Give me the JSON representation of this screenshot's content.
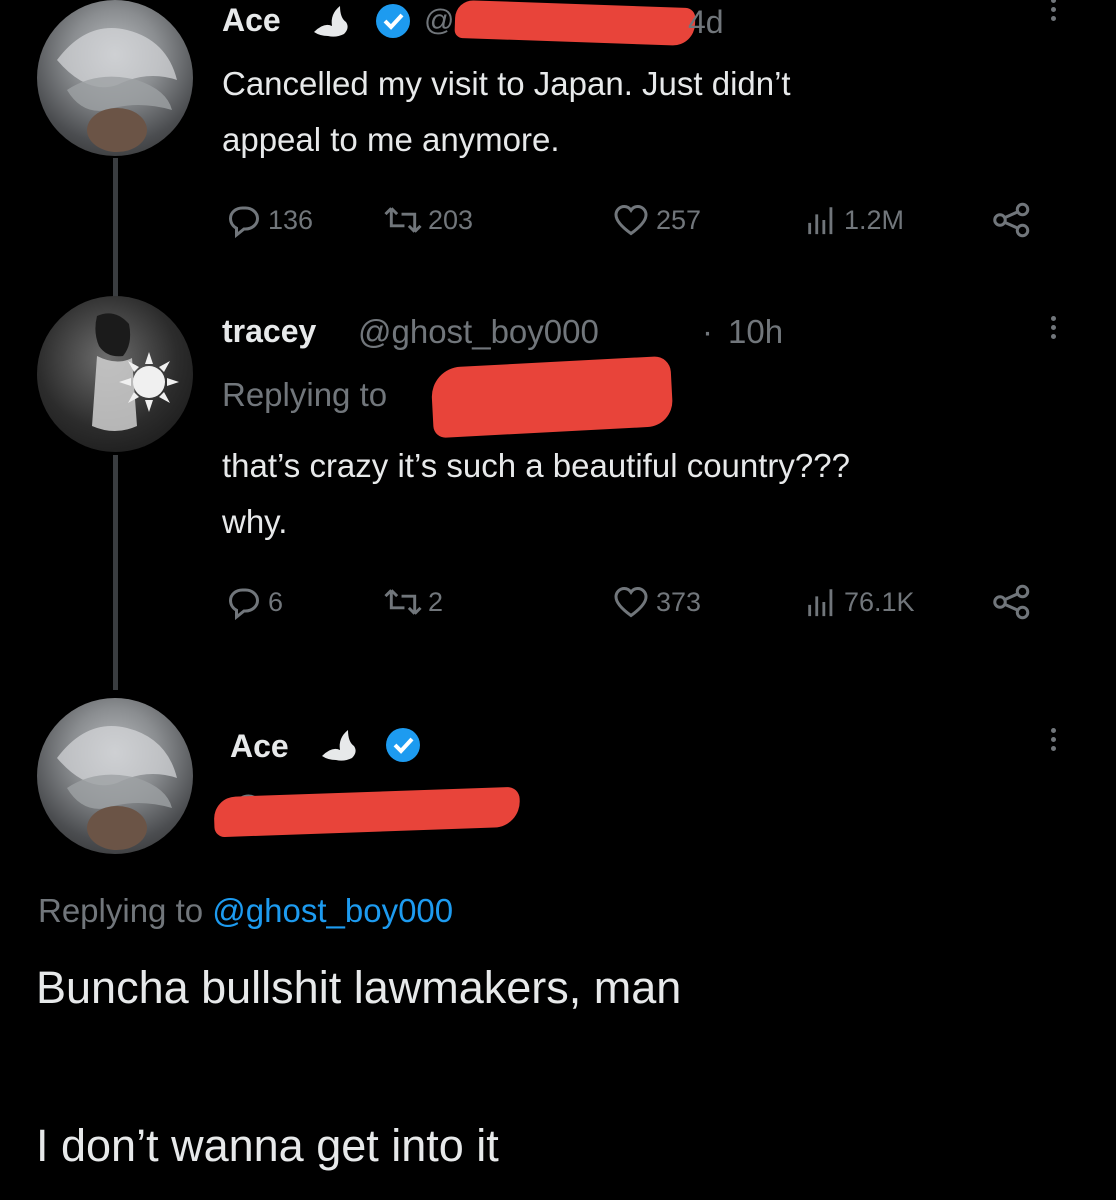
{
  "tweet1": {
    "name": "Ace",
    "handle_prefix": "@",
    "time": "4d",
    "text_line1": "Cancelled my visit to Japan. Just didn’t",
    "text_line2": "appeal to me anymore.",
    "stats": {
      "replies": "136",
      "retweets": "203",
      "likes": "257",
      "views": "1.2M"
    }
  },
  "tweet2": {
    "name": "tracey",
    "handle": "@ghost_boy000",
    "separator": "·",
    "time": "10h",
    "replying_label": "Replying to",
    "text_line1": "that’s crazy it’s such a beautiful country???",
    "text_line2": "why.",
    "stats": {
      "replies": "6",
      "retweets": "2",
      "likes": "373",
      "views": "76.1K"
    }
  },
  "tweet3": {
    "name": "Ace",
    "handle_prefix": "@",
    "replying_label": "Replying to",
    "replying_handle": "@ghost_boy000",
    "text_line1": "Buncha bullshit lawmakers, man",
    "text_line2": "I don’t wanna get into it"
  },
  "colors": {
    "background": "#000000",
    "text": "#e7e9ea",
    "muted": "#71767b",
    "link": "#1d9bf0",
    "verified": "#1d9bf0",
    "redaction": "#e8443a"
  },
  "icons": [
    "reply-icon",
    "retweet-icon",
    "like-icon",
    "views-icon",
    "share-icon",
    "verified-badge-icon",
    "dove-icon",
    "more-icon"
  ]
}
